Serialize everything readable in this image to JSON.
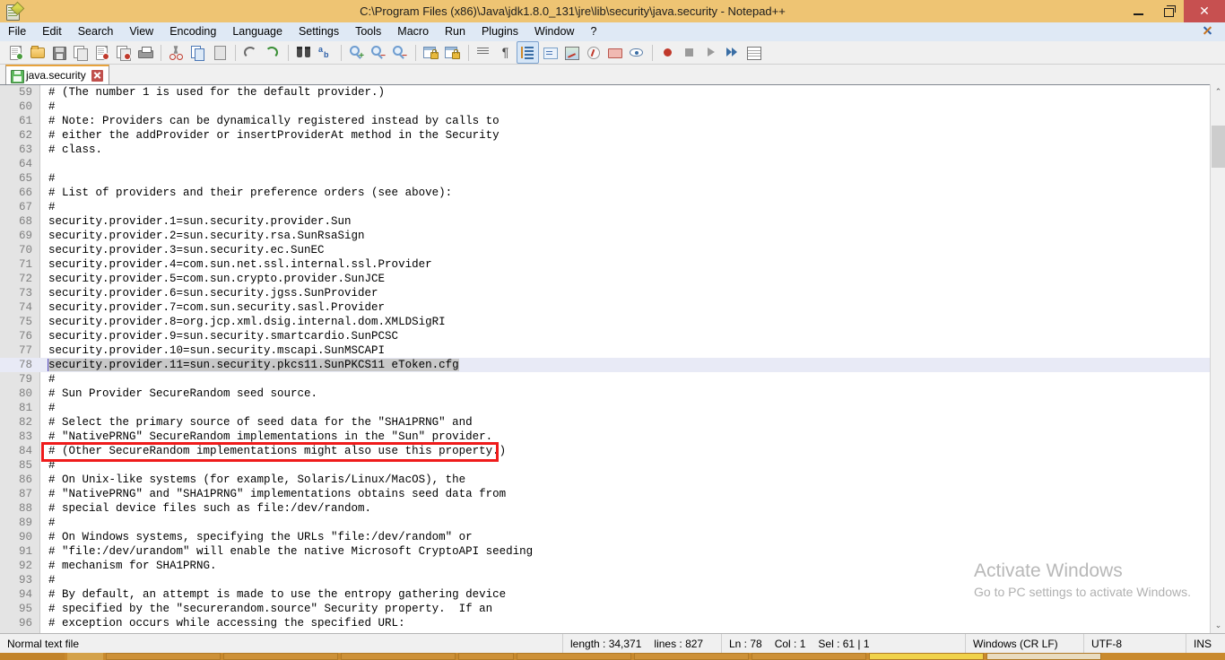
{
  "window": {
    "title": "C:\\Program Files (x86)\\Java\\jdk1.8.0_131\\jre\\lib\\security\\java.security - Notepad++",
    "app_icon": "notepad-plus-plus-icon",
    "minimize_label": "",
    "maximize_label": "",
    "close_label": "✕",
    "titlebar_color": "#eec473",
    "close_button_color": "#c75050"
  },
  "menu": {
    "items": [
      {
        "label": "File"
      },
      {
        "label": "Edit"
      },
      {
        "label": "Search"
      },
      {
        "label": "View"
      },
      {
        "label": "Encoding"
      },
      {
        "label": "Language"
      },
      {
        "label": "Settings"
      },
      {
        "label": "Tools"
      },
      {
        "label": "Macro"
      },
      {
        "label": "Run"
      },
      {
        "label": "Plugins"
      },
      {
        "label": "Window"
      },
      {
        "label": "?"
      }
    ],
    "document_close_label": "✕"
  },
  "toolbar": {
    "buttons": [
      {
        "name": "new-file-icon",
        "tooltip": "New"
      },
      {
        "name": "open-file-icon",
        "tooltip": "Open"
      },
      {
        "name": "save-icon",
        "tooltip": "Save"
      },
      {
        "name": "save-all-icon",
        "tooltip": "Save All"
      },
      {
        "name": "close-file-icon",
        "tooltip": "Close"
      },
      {
        "name": "close-all-files-icon",
        "tooltip": "Close All"
      },
      {
        "name": "print-icon",
        "tooltip": "Print"
      },
      {
        "name": "separator",
        "tooltip": ""
      },
      {
        "name": "cut-icon",
        "tooltip": "Cut"
      },
      {
        "name": "copy-icon",
        "tooltip": "Copy"
      },
      {
        "name": "paste-icon",
        "tooltip": "Paste"
      },
      {
        "name": "separator",
        "tooltip": ""
      },
      {
        "name": "undo-icon",
        "tooltip": "Undo"
      },
      {
        "name": "redo-icon",
        "tooltip": "Redo"
      },
      {
        "name": "separator",
        "tooltip": ""
      },
      {
        "name": "find-icon",
        "tooltip": "Find"
      },
      {
        "name": "replace-icon",
        "tooltip": "Replace"
      },
      {
        "name": "separator",
        "tooltip": ""
      },
      {
        "name": "zoom-in-icon",
        "tooltip": "Zoom In"
      },
      {
        "name": "zoom-out-icon",
        "tooltip": "Zoom Out"
      },
      {
        "name": "sync-scroll-vertical-icon",
        "tooltip": "Synchronize Vertical Scrolling"
      },
      {
        "name": "separator",
        "tooltip": ""
      },
      {
        "name": "word-wrap-lock-icon",
        "tooltip": "Word wrap"
      },
      {
        "name": "all-chars-lock-icon",
        "tooltip": "Show All Characters"
      },
      {
        "name": "separator",
        "tooltip": ""
      },
      {
        "name": "indent-guide-icon",
        "tooltip": "Show Indent Guide"
      },
      {
        "name": "pilcrow-icon",
        "tooltip": "Show All Characters"
      },
      {
        "name": "word-wrap-active-icon",
        "tooltip": "Word wrap"
      },
      {
        "name": "user-defined-dialog-icon",
        "tooltip": "User Defined Dialogue"
      },
      {
        "name": "document-map-icon",
        "tooltip": "Document Map"
      },
      {
        "name": "function-list-icon",
        "tooltip": "Function List"
      },
      {
        "name": "folder-as-workspace-icon",
        "tooltip": "Folder as Workspace"
      },
      {
        "name": "monitoring-icon",
        "tooltip": "Monitoring"
      },
      {
        "name": "separator",
        "tooltip": ""
      },
      {
        "name": "record-macro-icon",
        "tooltip": "Start Recording"
      },
      {
        "name": "stop-macro-icon",
        "tooltip": "Stop Recording"
      },
      {
        "name": "play-macro-icon",
        "tooltip": "Playback"
      },
      {
        "name": "run-macro-multiple-icon",
        "tooltip": "Run a Macro Multiple Times"
      },
      {
        "name": "save-macro-icon",
        "tooltip": "Save Current Recorded Macro"
      }
    ]
  },
  "tabs": [
    {
      "label": "java.security",
      "icon": "saved-file-icon",
      "close": "✕",
      "active": true
    }
  ],
  "editor": {
    "first_line": 59,
    "current_line": 78,
    "caret_line_index": 19,
    "lines": [
      {
        "n": "59",
        "text": "# (The number 1 is used for the default provider.)"
      },
      {
        "n": "60",
        "text": "#"
      },
      {
        "n": "61",
        "text": "# Note: Providers can be dynamically registered instead by calls to"
      },
      {
        "n": "62",
        "text": "# either the addProvider or insertProviderAt method in the Security"
      },
      {
        "n": "63",
        "text": "# class."
      },
      {
        "n": "64",
        "text": ""
      },
      {
        "n": "65",
        "text": "#"
      },
      {
        "n": "66",
        "text": "# List of providers and their preference orders (see above):"
      },
      {
        "n": "67",
        "text": "#"
      },
      {
        "n": "68",
        "text": "security.provider.1=sun.security.provider.Sun"
      },
      {
        "n": "69",
        "text": "security.provider.2=sun.security.rsa.SunRsaSign"
      },
      {
        "n": "70",
        "text": "security.provider.3=sun.security.ec.SunEC"
      },
      {
        "n": "71",
        "text": "security.provider.4=com.sun.net.ssl.internal.ssl.Provider"
      },
      {
        "n": "72",
        "text": "security.provider.5=com.sun.crypto.provider.SunJCE"
      },
      {
        "n": "73",
        "text": "security.provider.6=sun.security.jgss.SunProvider"
      },
      {
        "n": "74",
        "text": "security.provider.7=com.sun.security.sasl.Provider"
      },
      {
        "n": "75",
        "text": "security.provider.8=org.jcp.xml.dsig.internal.dom.XMLDSigRI"
      },
      {
        "n": "76",
        "text": "security.provider.9=sun.security.smartcardio.SunPCSC"
      },
      {
        "n": "77",
        "text": "security.provider.10=sun.security.mscapi.SunMSCAPI"
      },
      {
        "n": "78",
        "text": "security.provider.11=sun.security.pkcs11.SunPKCS11 eToken.cfg",
        "selected": true
      },
      {
        "n": "79",
        "text": "#"
      },
      {
        "n": "80",
        "text": "# Sun Provider SecureRandom seed source."
      },
      {
        "n": "81",
        "text": "#"
      },
      {
        "n": "82",
        "text": "# Select the primary source of seed data for the \"SHA1PRNG\" and"
      },
      {
        "n": "83",
        "text": "# \"NativePRNG\" SecureRandom implementations in the \"Sun\" provider."
      },
      {
        "n": "84",
        "text": "# (Other SecureRandom implementations might also use this property.)"
      },
      {
        "n": "85",
        "text": "#"
      },
      {
        "n": "86",
        "text": "# On Unix-like systems (for example, Solaris/Linux/MacOS), the"
      },
      {
        "n": "87",
        "text": "# \"NativePRNG\" and \"SHA1PRNG\" implementations obtains seed data from"
      },
      {
        "n": "88",
        "text": "# special device files such as file:/dev/random."
      },
      {
        "n": "89",
        "text": "#"
      },
      {
        "n": "90",
        "text": "# On Windows systems, specifying the URLs \"file:/dev/random\" or"
      },
      {
        "n": "91",
        "text": "# \"file:/dev/urandom\" will enable the native Microsoft CryptoAPI seeding"
      },
      {
        "n": "92",
        "text": "# mechanism for SHA1PRNG."
      },
      {
        "n": "93",
        "text": "#"
      },
      {
        "n": "94",
        "text": "# By default, an attempt is made to use the entropy gathering device"
      },
      {
        "n": "95",
        "text": "# specified by the \"securerandom.source\" Security property.  If an"
      },
      {
        "n": "96",
        "text": "# exception occurs while accessing the specified URL:"
      }
    ],
    "annotation": {
      "type": "red-rectangle-highlight",
      "color": "#ef1b1b",
      "target_line": "78"
    }
  },
  "watermark": {
    "line1": "Activate Windows",
    "line2": "Go to PC settings to activate Windows."
  },
  "scrollbar": {
    "up_arrow": "⌃",
    "down_arrow": "⌄"
  },
  "statusbar": {
    "file_type": "Normal text file",
    "length_label": "length : 34,371",
    "lines_label": "lines : 827",
    "ln": "Ln : 78",
    "col": "Col : 1",
    "sel": "Sel : 61 | 1",
    "eol": "Windows (CR LF)",
    "encoding": "UTF-8",
    "insert_mode": "INS"
  },
  "taskbar": {
    "color": "#c98a2e",
    "items": [
      "app-1",
      "app-2",
      "app-3",
      "app-4",
      "app-5",
      "app-6",
      "app-7",
      "app-8",
      "app-9",
      "app-10"
    ]
  }
}
